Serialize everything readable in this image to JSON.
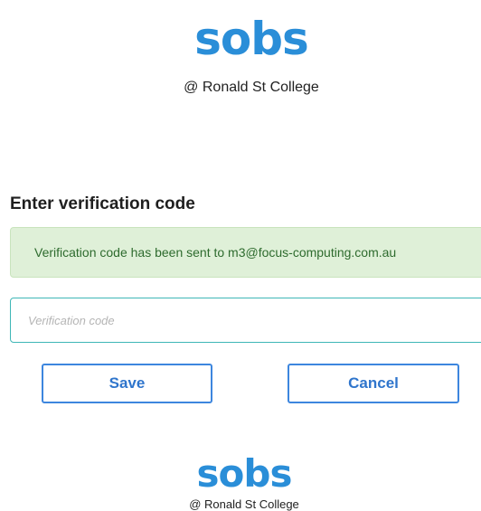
{
  "header": {
    "logo_text": "sobs",
    "subtitle": "@ Ronald St College"
  },
  "form": {
    "title": "Enter verification code",
    "alert_message": "Verification code has been sent to m3@focus-computing.com.au",
    "code_input": {
      "placeholder": "Verification code",
      "value": ""
    },
    "save_label": "Save",
    "cancel_label": "Cancel"
  },
  "footer": {
    "logo_text": "sobs",
    "subtitle": "@ Ronald St College"
  },
  "colors": {
    "brand": "#2a8ed8",
    "button_border": "#3d86de",
    "alert_bg": "#dff0d8",
    "alert_text": "#2e6b2e",
    "input_border": "#3fb7b7"
  }
}
